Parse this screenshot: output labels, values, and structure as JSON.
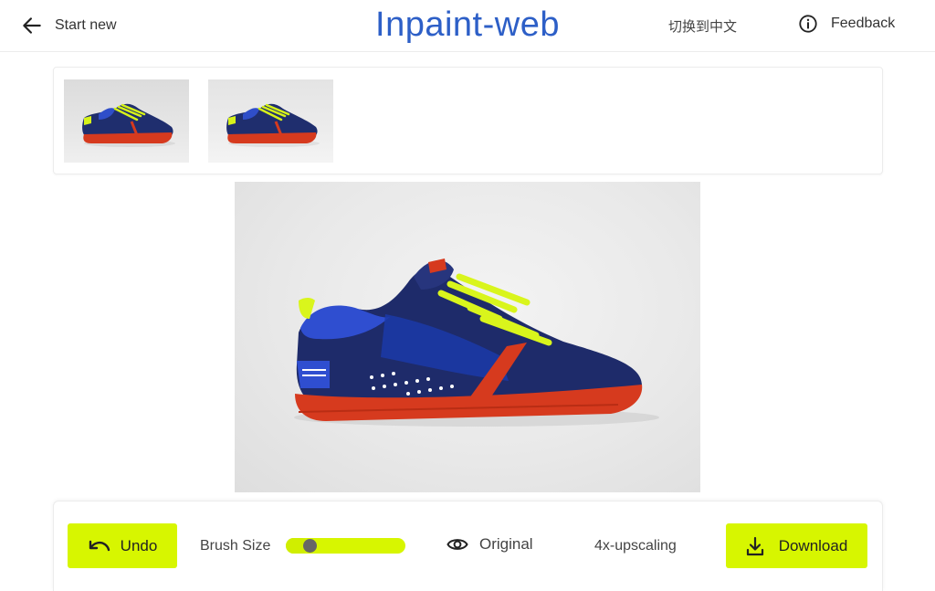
{
  "header": {
    "back_label": "Start new",
    "title": "Inpaint-web",
    "language_label": "切换到中文",
    "feedback_label": "Feedback"
  },
  "thumbnails": [
    {
      "name": "original-shoe"
    },
    {
      "name": "edited-shoe"
    }
  ],
  "toolbar": {
    "undo_label": "Undo",
    "brush_size_label": "Brush Size",
    "brush_size_value": 0.2,
    "original_label": "Original",
    "upscale_label": "4x-upscaling",
    "download_label": "Download"
  },
  "colors": {
    "accent": "#d7f600",
    "title": "#2d5fc7"
  },
  "icons": {
    "back": "arrow-left-icon",
    "feedback": "info-icon",
    "undo": "undo-icon",
    "original": "eye-icon",
    "download": "download-icon"
  }
}
